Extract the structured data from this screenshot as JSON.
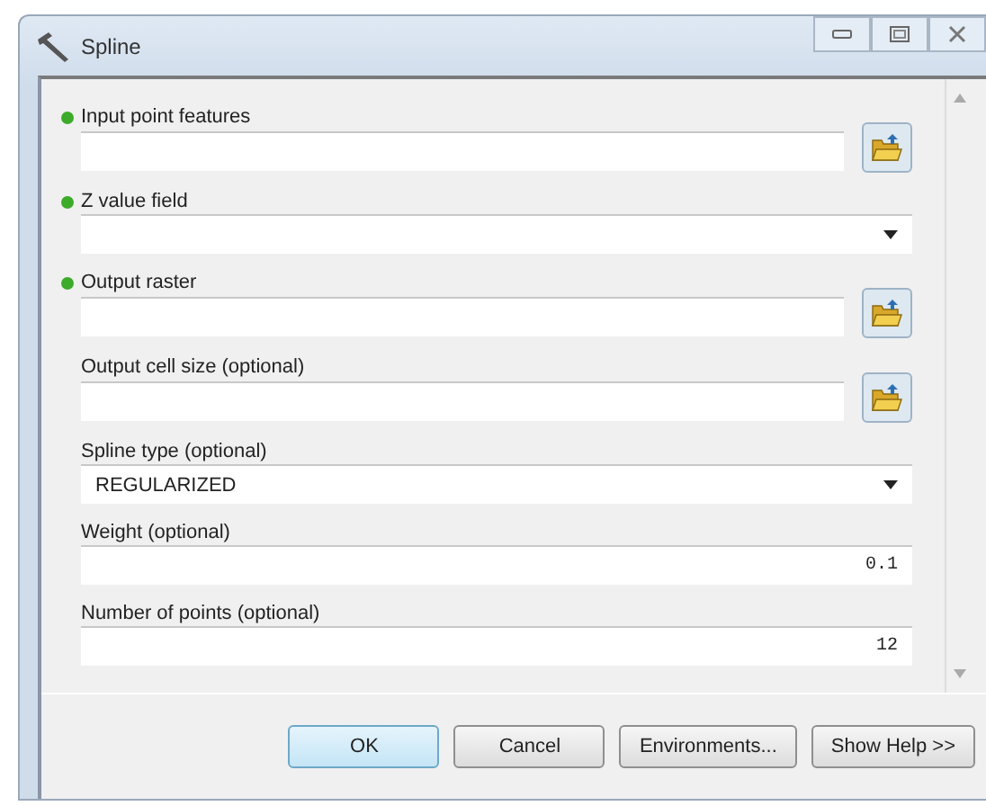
{
  "window": {
    "title": "Spline"
  },
  "parameters": [
    {
      "label": "Input point features",
      "kind": "browse",
      "required": true
    },
    {
      "label": "Z value field",
      "kind": "dropdown",
      "required": true
    },
    {
      "label": "Output raster",
      "kind": "browse",
      "required": true
    },
    {
      "label": "Output cell size (optional)",
      "kind": "browse",
      "required": false
    },
    {
      "label": "Spline type (optional)",
      "kind": "dropdown",
      "required": false,
      "value": "REGULARIZED"
    },
    {
      "label": "Weight (optional)",
      "kind": "number",
      "required": false,
      "value": "0.1"
    },
    {
      "label": "Number of points (optional)",
      "kind": "number",
      "required": false,
      "value": "12"
    }
  ],
  "buttons": [
    "OK",
    "Cancel",
    "Environments...",
    "Show Help >>"
  ]
}
